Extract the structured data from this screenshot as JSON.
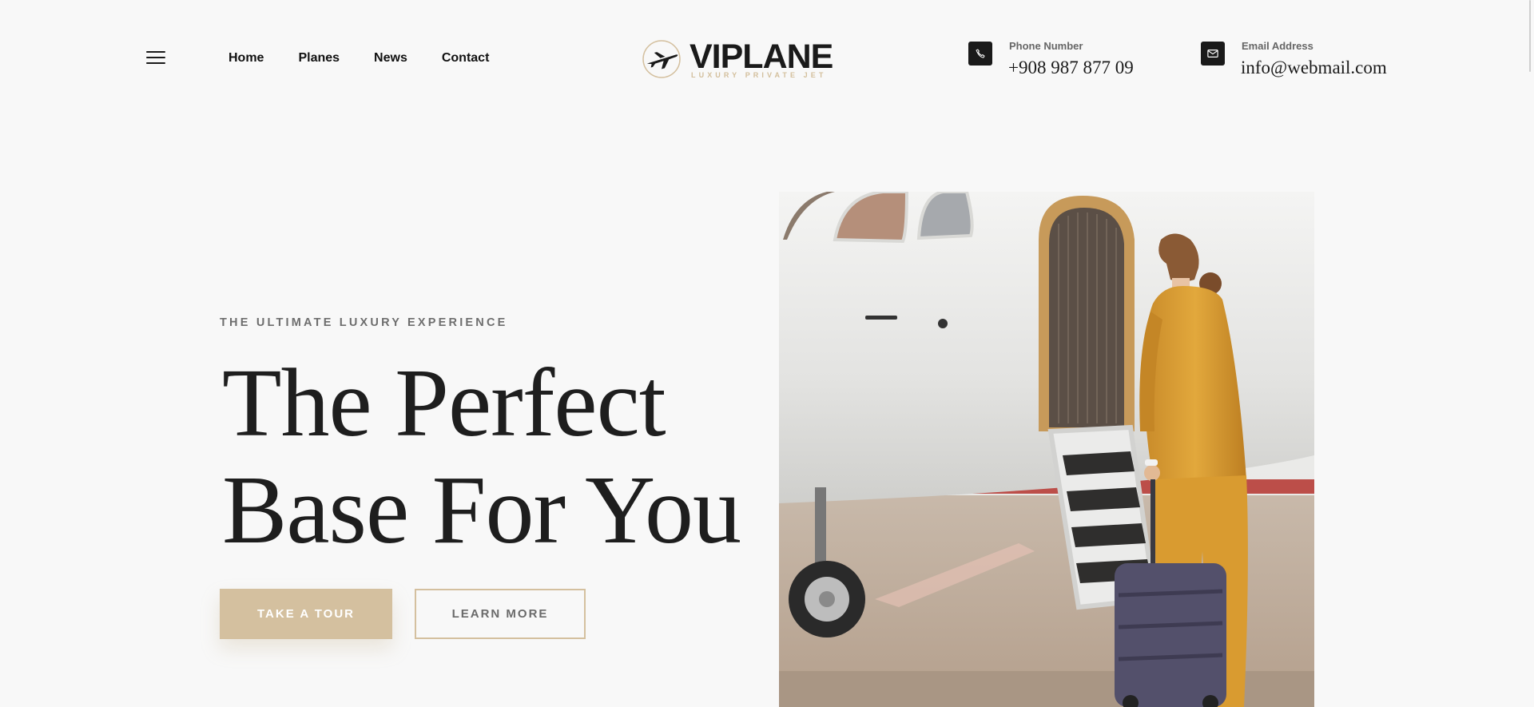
{
  "header": {
    "nav": [
      "Home",
      "Planes",
      "News",
      "Contact"
    ],
    "logo": {
      "name": "VIPLANE",
      "tagline": "LUXURY PRIVATE JET"
    },
    "phone": {
      "label": "Phone Number",
      "value": "+908 987 877 09",
      "icon": "phone-icon"
    },
    "email": {
      "label": "Email Address",
      "value": "info@webmail.com",
      "icon": "mail-icon"
    }
  },
  "hero": {
    "eyebrow": "THE ULTIMATE LUXURY EXPERIENCE",
    "title_line1": "The Perfect",
    "title_line2": "Base For You",
    "primary_button": "TAKE A TOUR",
    "secondary_button": "LEARN MORE",
    "image": "woman-boarding-private-jet-photo"
  },
  "colors": {
    "accent": "#d4c09f",
    "background": "#f8f8f8",
    "text": "#1e1e1e"
  }
}
